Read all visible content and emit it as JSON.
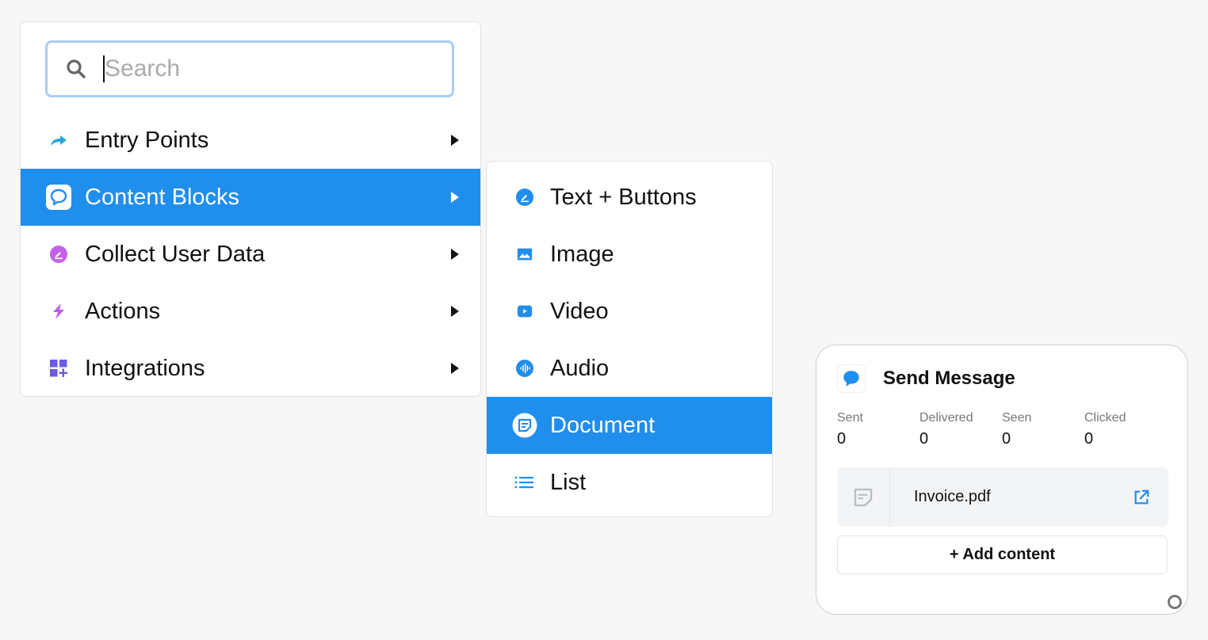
{
  "search": {
    "placeholder": "Search",
    "value": ""
  },
  "main_menu": {
    "items": [
      {
        "label": "Entry Points",
        "icon": "share-arrow-icon",
        "active": false,
        "has_submenu": true
      },
      {
        "label": "Content Blocks",
        "icon": "message-bubble-icon",
        "active": true,
        "has_submenu": true
      },
      {
        "label": "Collect User Data",
        "icon": "edit-circle-icon",
        "active": false,
        "has_submenu": true
      },
      {
        "label": "Actions",
        "icon": "lightning-icon",
        "active": false,
        "has_submenu": true
      },
      {
        "label": "Integrations",
        "icon": "apps-add-icon",
        "active": false,
        "has_submenu": true
      }
    ]
  },
  "sub_menu": {
    "items": [
      {
        "label": "Text + Buttons",
        "icon": "edit-circle-icon",
        "active": false
      },
      {
        "label": "Image",
        "icon": "image-icon",
        "active": false
      },
      {
        "label": "Video",
        "icon": "video-play-icon",
        "active": false
      },
      {
        "label": "Audio",
        "icon": "audio-wave-icon",
        "active": false
      },
      {
        "label": "Document",
        "icon": "document-icon",
        "active": true
      },
      {
        "label": "List",
        "icon": "list-icon",
        "active": false
      }
    ]
  },
  "node": {
    "title": "Send Message",
    "stats": [
      {
        "label": "Sent",
        "value": "0"
      },
      {
        "label": "Delivered",
        "value": "0"
      },
      {
        "label": "Seen",
        "value": "0"
      },
      {
        "label": "Clicked",
        "value": "0"
      }
    ],
    "file": {
      "name": "Invoice.pdf"
    },
    "add_content_label": "+ Add content"
  },
  "colors": {
    "accent": "#208eed",
    "entry_points_icon": "#2aa5dc",
    "collect_icon": "#c560e8",
    "actions_icon": "#b85df0",
    "integrations_icon": "#6a5ae0",
    "background": "#f7f7f7"
  }
}
